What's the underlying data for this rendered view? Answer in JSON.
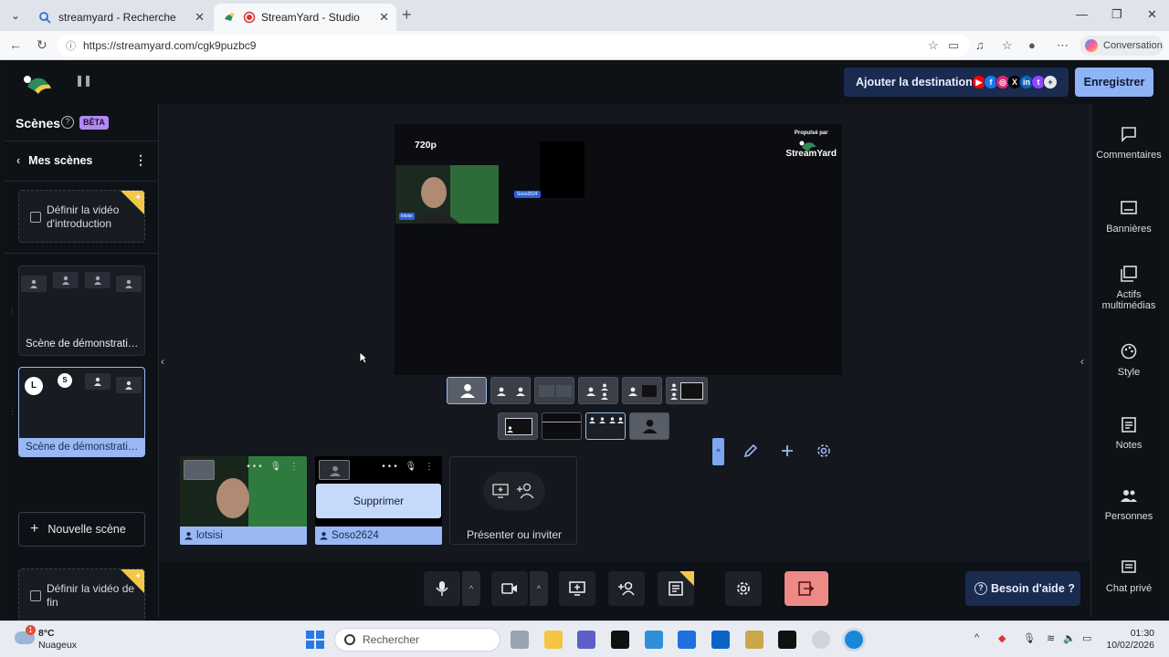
{
  "browser": {
    "tabs": [
      {
        "label": "streamyard - Recherche"
      },
      {
        "label": "StreamYard - Studio"
      }
    ],
    "url": "https://streamyard.com/cgk9puzbc9",
    "conversation_label": "Conversation"
  },
  "header": {
    "add_destination": "Ajouter la destination",
    "record": "Enregistrer",
    "accent": "#8fb4f5"
  },
  "scenes": {
    "title": "Scènes",
    "beta": "BÊTA",
    "my_scenes": "Mes scènes",
    "intro_video": "Définir la vidéo d'introduction",
    "scene1": "Scène de démonstrati…",
    "scene2": "Scène de démonstrati…",
    "scene2_avatars": [
      "L",
      "S"
    ],
    "new_scene": "Nouvelle scène",
    "outro_video": "Définir la vidéo de fin"
  },
  "stage": {
    "resolution": "720p",
    "powered_by": "Propulsé par",
    "brand": "StreamYard",
    "name_tag_2": "Soso2624"
  },
  "participants": [
    {
      "name": "lotsisi"
    },
    {
      "name": "Soso2624",
      "hover_action": "Supprimer"
    }
  ],
  "invite": {
    "label": "Présenter ou inviter"
  },
  "bottom": {
    "help": "Besoin d'aide ?"
  },
  "right_panel": [
    {
      "label": "Commentaires",
      "icon": "comment-icon"
    },
    {
      "label": "Bannières",
      "icon": "banner-icon"
    },
    {
      "label": "Actifs multimédias",
      "icon": "media-icon"
    },
    {
      "label": "Style",
      "icon": "palette-icon"
    },
    {
      "label": "Notes",
      "icon": "notes-icon"
    },
    {
      "label": "Personnes",
      "icon": "people-icon"
    },
    {
      "label": "Chat privé",
      "icon": "chat-icon"
    }
  ],
  "taskbar": {
    "temp": "8°C",
    "weather": "Nuageux",
    "weather_badge": "1",
    "search_placeholder": "Rechercher",
    "time": "01:30",
    "date": "10/02/2026"
  }
}
